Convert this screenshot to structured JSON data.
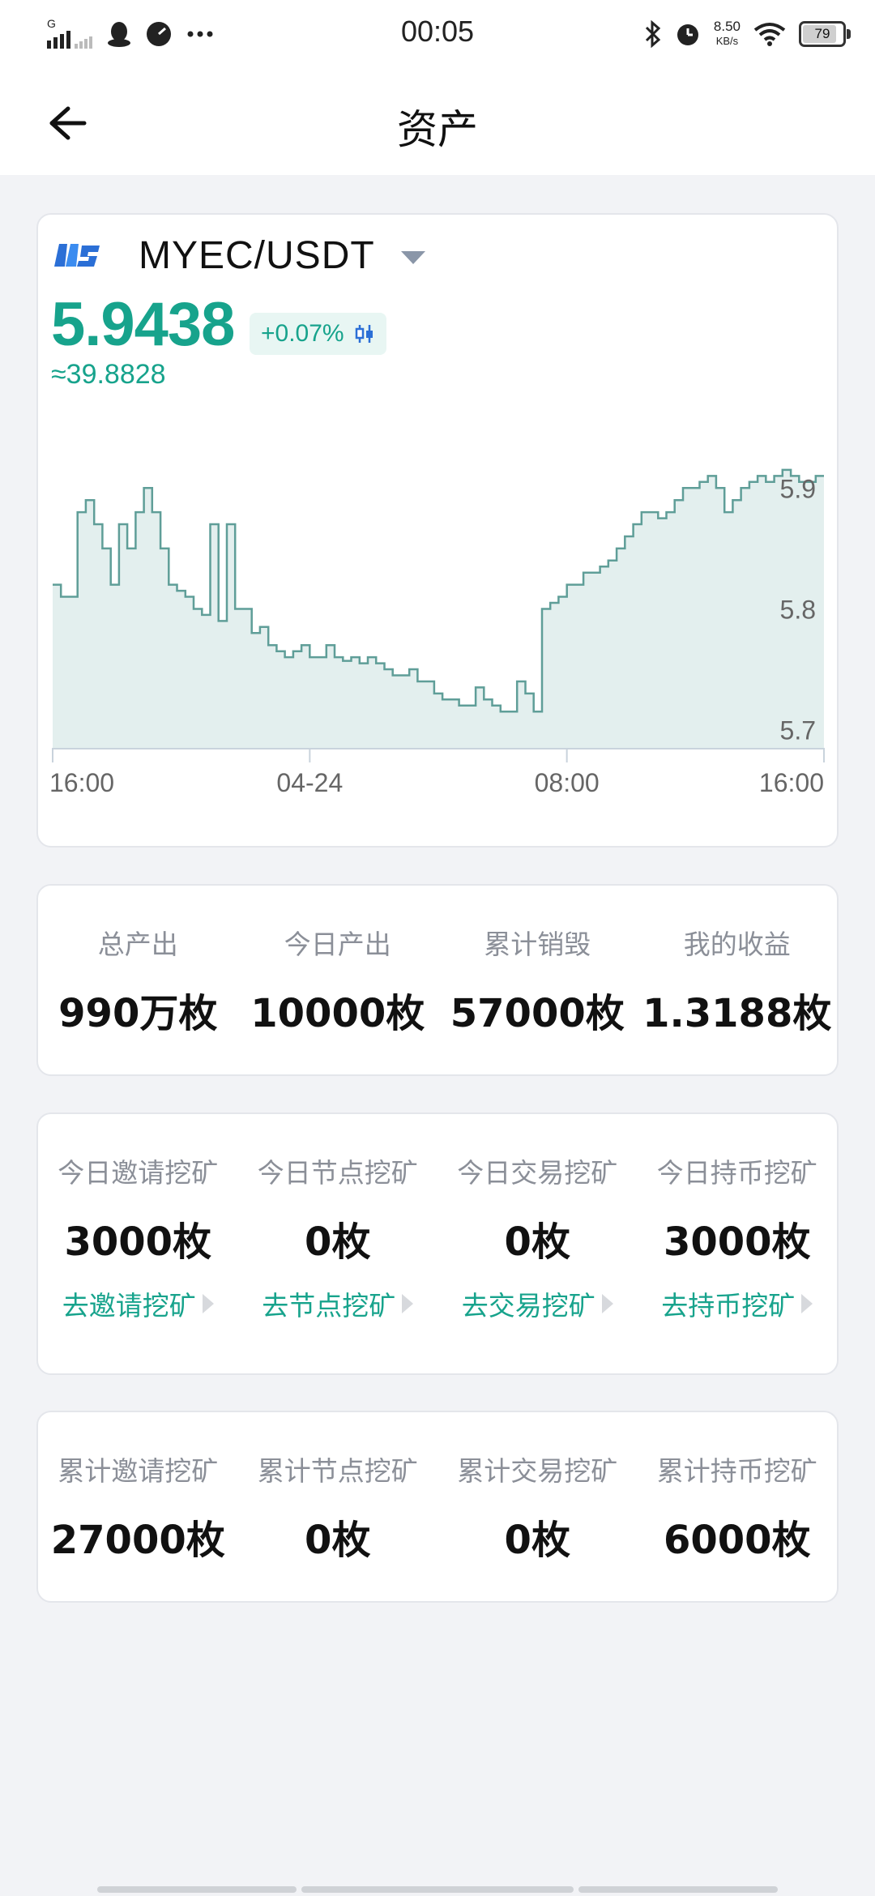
{
  "status_bar": {
    "time": "00:05",
    "net_speed_value": "8.50",
    "net_speed_unit": "KB/s",
    "battery": "79",
    "network_label": "G"
  },
  "nav": {
    "title": "资产"
  },
  "market": {
    "pair": "MYEC/USDT",
    "price": "5.9438",
    "change": "+0.07%",
    "approx": "≈39.8828",
    "accent_color": "#17a38c"
  },
  "chart_data": {
    "type": "area",
    "x_ticks": [
      "16:00",
      "04-24",
      "08:00",
      "16:00"
    ],
    "y_ticks": [
      5.9,
      5.8,
      5.7
    ],
    "ylim": [
      5.685,
      5.925
    ],
    "values": [
      5.82,
      5.81,
      5.81,
      5.88,
      5.89,
      5.87,
      5.85,
      5.82,
      5.87,
      5.85,
      5.88,
      5.9,
      5.88,
      5.85,
      5.82,
      5.815,
      5.81,
      5.8,
      5.795,
      5.87,
      5.79,
      5.87,
      5.8,
      5.8,
      5.78,
      5.785,
      5.77,
      5.765,
      5.76,
      5.765,
      5.77,
      5.76,
      5.76,
      5.77,
      5.76,
      5.757,
      5.76,
      5.755,
      5.76,
      5.755,
      5.75,
      5.745,
      5.745,
      5.75,
      5.74,
      5.74,
      5.73,
      5.725,
      5.725,
      5.72,
      5.72,
      5.735,
      5.725,
      5.72,
      5.715,
      5.715,
      5.74,
      5.73,
      5.715,
      5.8,
      5.805,
      5.81,
      5.82,
      5.82,
      5.83,
      5.83,
      5.835,
      5.84,
      5.85,
      5.86,
      5.87,
      5.88,
      5.88,
      5.875,
      5.88,
      5.89,
      5.9,
      5.9,
      5.905,
      5.91,
      5.9,
      5.88,
      5.89,
      5.9,
      5.905,
      5.91,
      5.905,
      5.91,
      5.915,
      5.91,
      5.905,
      5.905,
      5.91
    ]
  },
  "overview": [
    {
      "label": "总产出",
      "value": "990万枚"
    },
    {
      "label": "今日产出",
      "value": "10000枚"
    },
    {
      "label": "累计销毁",
      "value": "57000枚"
    },
    {
      "label": "我的收益",
      "value": "1.3188枚"
    }
  ],
  "today_mining": [
    {
      "label": "今日邀请挖矿",
      "value": "3000枚",
      "link": "去邀请挖矿"
    },
    {
      "label": "今日节点挖矿",
      "value": "0枚",
      "link": "去节点挖矿"
    },
    {
      "label": "今日交易挖矿",
      "value": "0枚",
      "link": "去交易挖矿"
    },
    {
      "label": "今日持币挖矿",
      "value": "3000枚",
      "link": "去持币挖矿"
    }
  ],
  "total_mining": [
    {
      "label": "累计邀请挖矿",
      "value": "27000枚"
    },
    {
      "label": "累计节点挖矿",
      "value": "0枚"
    },
    {
      "label": "累计交易挖矿",
      "value": "0枚"
    },
    {
      "label": "累计持币挖矿",
      "value": "6000枚"
    }
  ]
}
